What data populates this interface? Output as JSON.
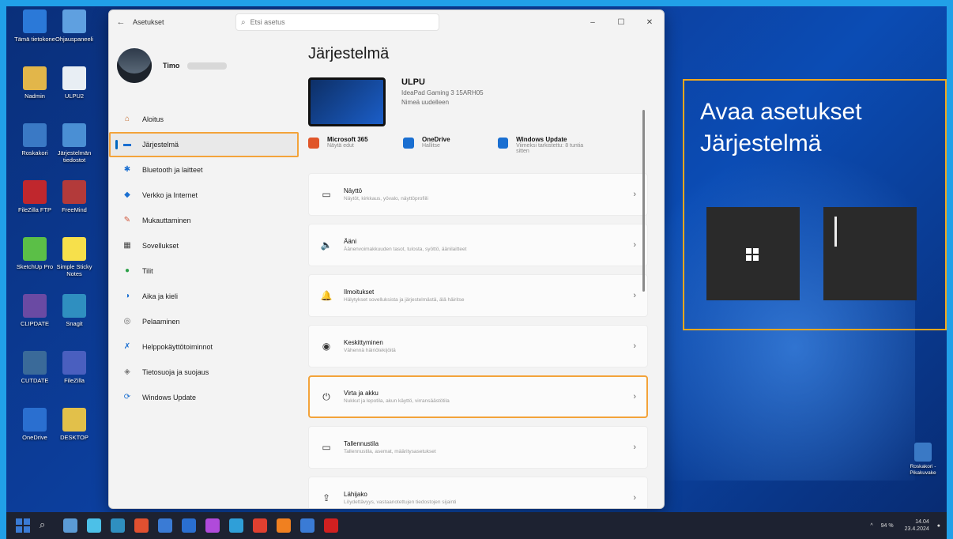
{
  "desktop": {
    "icons": [
      {
        "label": "Tämä tietokone",
        "color": "#2b79d8"
      },
      {
        "label": "Ohjauspaneeli",
        "color": "#5fa0e0"
      },
      {
        "label": "Nadmin",
        "color": "#e2b64a"
      },
      {
        "label": "ULPU2",
        "color": "#e8eef4"
      },
      {
        "label": "Roskakori",
        "color": "#3a79c5"
      },
      {
        "label": "Järjestelmän tiedostot",
        "color": "#4a8fd4"
      },
      {
        "label": "FileZilla FTP",
        "color": "#c0272d"
      },
      {
        "label": "FreeMind",
        "color": "#b33a3a"
      },
      {
        "label": "SketchUp Pro",
        "color": "#5bbf47"
      },
      {
        "label": "Simple Sticky Notes",
        "color": "#f7e04b"
      },
      {
        "label": "CLIPDATE",
        "color": "#6a4aa3"
      },
      {
        "label": "Snagit",
        "color": "#2f8fc0"
      },
      {
        "label": "CUTDATE",
        "color": "#3a6a99"
      },
      {
        "label": "FileZilla",
        "color": "#4a5fbf"
      },
      {
        "label": "OneDrive",
        "color": "#2a6fd0"
      },
      {
        "label": "DESKTOP",
        "color": "#e2c04a"
      }
    ],
    "recycle_label": "Roskakori - Pikakuvake"
  },
  "window": {
    "title": "Asetukset",
    "search_placeholder": "Etsi asetus",
    "controls": [
      "–",
      "☐",
      "✕"
    ]
  },
  "profile": {
    "name": "Timo"
  },
  "sidebar": {
    "items": [
      {
        "label": "Aloitus",
        "icon": "home-icon",
        "glyph": "⌂",
        "color": "#c36a2a"
      },
      {
        "label": "Järjestelmä",
        "icon": "system-icon",
        "glyph": "▬",
        "color": "#1a6fd1",
        "active": true
      },
      {
        "label": "Bluetooth ja laitteet",
        "icon": "bluetooth-icon",
        "glyph": "✱",
        "color": "#1a6fd1"
      },
      {
        "label": "Verkko ja Internet",
        "icon": "network-icon",
        "glyph": "◆",
        "color": "#1a6fd1"
      },
      {
        "label": "Mukauttaminen",
        "icon": "brush-icon",
        "glyph": "✎",
        "color": "#d0553a"
      },
      {
        "label": "Sovellukset",
        "icon": "apps-icon",
        "glyph": "▦",
        "color": "#444"
      },
      {
        "label": "Tilit",
        "icon": "accounts-icon",
        "glyph": "●",
        "color": "#2ea24a"
      },
      {
        "label": "Aika ja kieli",
        "icon": "time-language-icon",
        "glyph": "◑",
        "color": "#1a6fd1"
      },
      {
        "label": "Pelaaminen",
        "icon": "gaming-icon",
        "glyph": "◎",
        "color": "#666"
      },
      {
        "label": "Helppokäyttötoiminnot",
        "icon": "accessibility-icon",
        "glyph": "✗",
        "color": "#1a6fd1"
      },
      {
        "label": "Tietosuoja ja suojaus",
        "icon": "shield-icon",
        "glyph": "◈",
        "color": "#777"
      },
      {
        "label": "Windows Update",
        "icon": "update-icon",
        "glyph": "⟳",
        "color": "#1a6fd1"
      }
    ]
  },
  "main": {
    "heading": "Järjestelmä",
    "device": {
      "name": "ULPU",
      "model": "IdeaPad Gaming 3 15ARH05",
      "rename": "Nimeä uudelleen"
    },
    "quick": [
      {
        "title": "Microsoft 365",
        "sub": "Näytä edut",
        "color": "#e0562a"
      },
      {
        "title": "OneDrive",
        "sub": "Hallitse",
        "color": "#1a6fd1"
      },
      {
        "title": "Windows Update",
        "sub": "Viimeksi tarkistettu: 8 tuntia sitten",
        "color": "#1a6fd1"
      }
    ],
    "cards": [
      {
        "title": "Näyttö",
        "sub": "Näytöt, kirkkaus, yövalo, näyttöprofiili",
        "icon": "display-icon",
        "glyph": "▭"
      },
      {
        "title": "Ääni",
        "sub": "Äänenvoimakkuuden tasot, tulosta, syöttö, äänilaitteet",
        "icon": "sound-icon",
        "glyph": "🔈"
      },
      {
        "title": "Ilmoitukset",
        "sub": "Hälytykset sovelluksista ja järjestelmästä, älä häiritse",
        "icon": "bell-icon",
        "glyph": "🔔"
      },
      {
        "title": "Keskittyminen",
        "sub": "Vähennä häiriötekijöitä",
        "icon": "focus-icon",
        "glyph": "◉"
      },
      {
        "title": "Virta ja akku",
        "sub": "Nukkut ja lepotila, akun käyttö, virransäästötila",
        "icon": "power-icon",
        "glyph": "⏻",
        "highlight": true
      },
      {
        "title": "Tallennustila",
        "sub": "Tallennustila, asemat, määritysasetukset",
        "icon": "storage-icon",
        "glyph": "▭"
      },
      {
        "title": "Lähijako",
        "sub": "Löydettävyys, vastaanotettujen tiedostojen sijainti",
        "icon": "share-icon",
        "glyph": "⇪"
      }
    ]
  },
  "overlay": {
    "line1": "Avaa asetukset",
    "line2": "Järjestelmä"
  },
  "taskbar": {
    "apps": [
      "#3a7bd5",
      "#3a7bd5",
      "#5b9bd5",
      "#4cc0e8",
      "#2f8fc0",
      "#e05030",
      "#3a7bd5",
      "#2a6fd0",
      "#b04adb",
      "#2f9fd8",
      "#e04030",
      "#f08020",
      "#3a7bd5",
      "#d02020"
    ],
    "time": "14.04",
    "date": "23.4.2024",
    "battery": "94 %"
  }
}
